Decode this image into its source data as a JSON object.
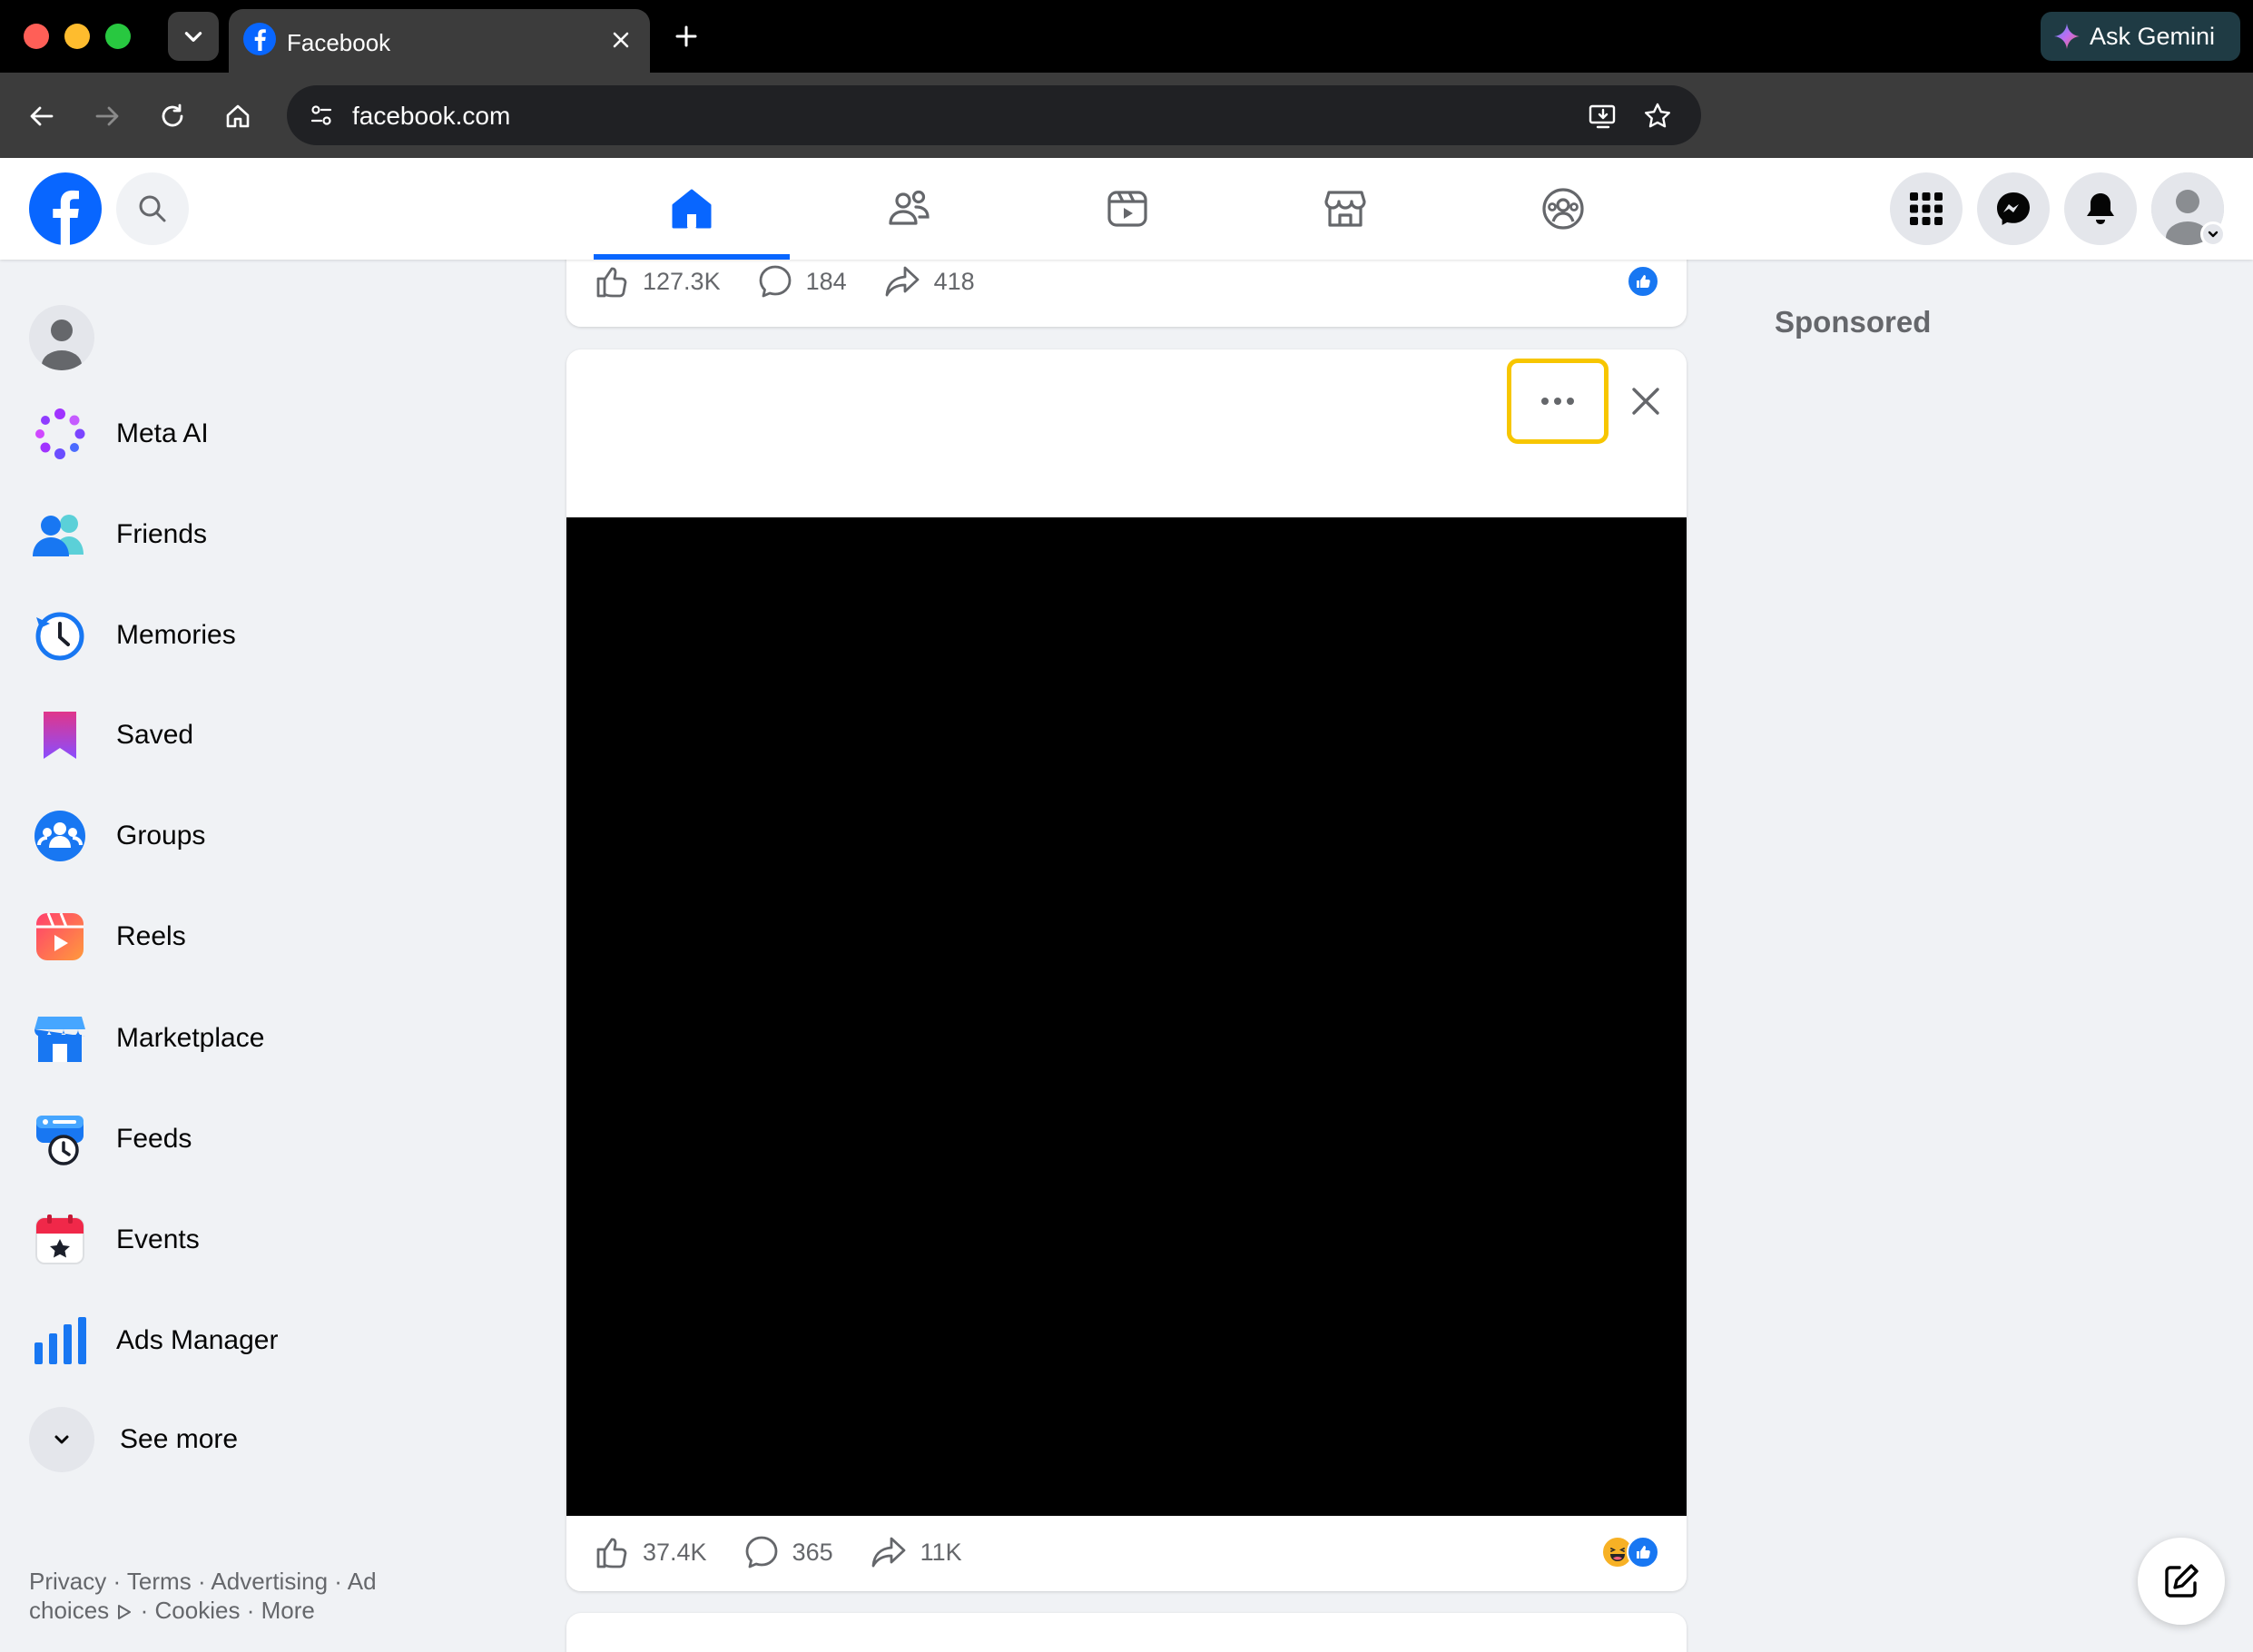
{
  "browser": {
    "tab_title": "Facebook",
    "url": "facebook.com",
    "gemini_label": "Ask Gemini"
  },
  "colors": {
    "fb_blue": "#0866ff",
    "highlight": "#f7c600"
  },
  "nav": {
    "active_tab": "home",
    "tabs": [
      "home-icon",
      "friends-icon",
      "video-icon",
      "marketplace-icon",
      "groups-icon"
    ]
  },
  "sidebar": {
    "items": [
      {
        "label": "Meta AI",
        "icon": "meta-ai-icon"
      },
      {
        "label": "Friends",
        "icon": "friends-icon"
      },
      {
        "label": "Memories",
        "icon": "memories-icon"
      },
      {
        "label": "Saved",
        "icon": "saved-icon"
      },
      {
        "label": "Groups",
        "icon": "groups-icon"
      },
      {
        "label": "Reels",
        "icon": "reels-icon"
      },
      {
        "label": "Marketplace",
        "icon": "marketplace-icon"
      },
      {
        "label": "Feeds",
        "icon": "feeds-icon"
      },
      {
        "label": "Events",
        "icon": "events-icon"
      },
      {
        "label": "Ads Manager",
        "icon": "ads-manager-icon"
      }
    ],
    "see_more": "See more",
    "footer": {
      "privacy": "Privacy",
      "terms": "Terms",
      "advertising": "Advertising",
      "ad_choices": "Ad choices",
      "cookies": "Cookies",
      "more": "More",
      "sep": "·"
    }
  },
  "feed": {
    "post_top": {
      "likes": "127.3K",
      "comments": "184",
      "shares": "418"
    },
    "post_main": {
      "likes": "37.4K",
      "comments": "365",
      "shares": "11K"
    }
  },
  "right": {
    "sponsored": "Sponsored"
  }
}
